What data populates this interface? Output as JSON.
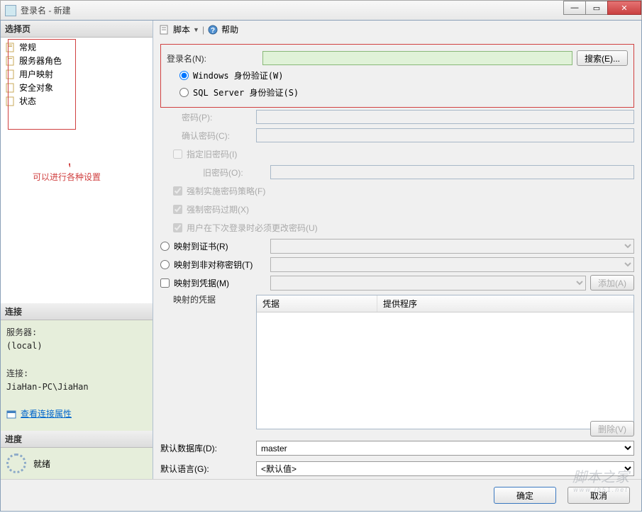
{
  "window": {
    "title": "登录名 - 新建"
  },
  "sidebar": {
    "select_header": "选择页",
    "items": [
      "常规",
      "服务器角色",
      "用户映射",
      "安全对象",
      "状态"
    ],
    "annotation": "可以进行各种设置",
    "conn_header": "连接",
    "server_label": "服务器:",
    "server_value": "(local)",
    "conn_label": "连接:",
    "conn_value": "JiaHan-PC\\JiaHan",
    "view_link": "查看连接属性",
    "progress_header": "进度",
    "ready": "就绪"
  },
  "toolbar": {
    "script": "脚本",
    "help": "帮助"
  },
  "form": {
    "login_label": "登录名(N):",
    "search_btn": "搜索(E)...",
    "auth_windows": "Windows 身份验证(W)",
    "auth_sql": "SQL Server 身份验证(S)",
    "password": "密码(P):",
    "confirm_password": "确认密码(C):",
    "specify_old": "指定旧密码(I)",
    "old_password": "旧密码(O):",
    "enforce_policy": "强制实施密码策略(F)",
    "enforce_expire": "强制密码过期(X)",
    "must_change": "用户在下次登录时必须更改密码(U)",
    "map_cert": "映射到证书(R)",
    "map_asym": "映射到非对称密钥(T)",
    "map_cred": "映射到凭据(M)",
    "add_btn": "添加(A)",
    "mapped_cred": "映射的凭据",
    "col_cred": "凭据",
    "col_provider": "提供程序",
    "delete_btn": "删除(V)",
    "default_db": "默认数据库(D):",
    "default_db_val": "master",
    "default_lang": "默认语言(G):",
    "default_lang_val": "<默认值>"
  },
  "footer": {
    "ok": "确定",
    "cancel": "取消"
  },
  "watermark": {
    "main": "脚本之家",
    "sub": "www.jb51.net"
  }
}
